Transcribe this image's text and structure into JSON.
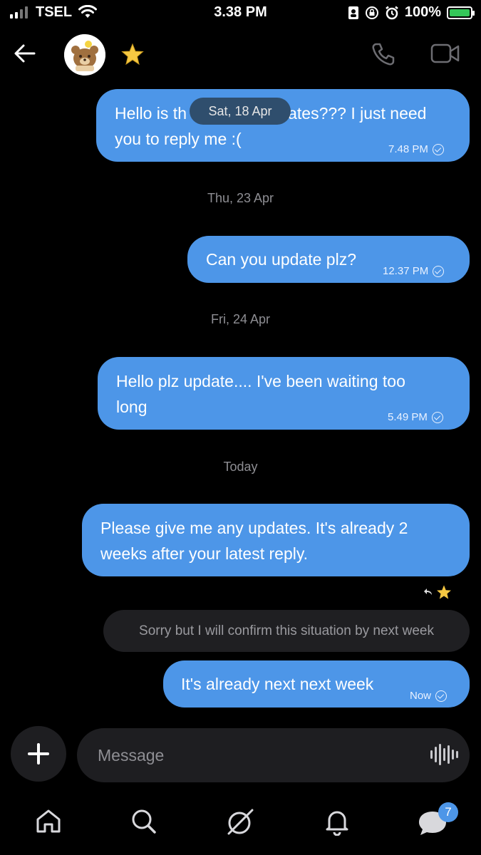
{
  "status_bar": {
    "carrier": "TSEL",
    "time": "3.38 PM",
    "battery": "100%",
    "battery_level": 1.0
  },
  "header": {
    "back_icon": "arrow-left-icon",
    "avatar_icon": "bear-avatar",
    "favorite_icon": "star-icon",
    "call_icon": "phone-icon",
    "video_icon": "video-camera-icon"
  },
  "sticky_date": "Sat, 18 Apr",
  "messages": [
    {
      "text": "Hello is there any updates??? I just need you to reply me :(",
      "time": "7.48 PM"
    },
    {
      "date": "Thu, 23 Apr"
    },
    {
      "text": "Can you update plz?",
      "time": "12.37 PM"
    },
    {
      "date": "Fri, 24 Apr"
    },
    {
      "text": "Hello plz update.... I've been waiting too long",
      "time": "5.49 PM"
    },
    {
      "date": "Today"
    },
    {
      "text": "Please give me any updates. It's already 2 weeks after your latest reply."
    },
    {
      "received_text": "Sorry but I will confirm this situation by next week"
    },
    {
      "text": "It's already next next week",
      "time": "Now"
    }
  ],
  "bubble_lines": {
    "m1_line1_left": "Hello is th",
    "m1_line1_right": "lates??? I just need",
    "m1_line2": "you to reply me :(",
    "m3_line1": "Hello plz update.... I've been waiting too",
    "m3_line2": "long",
    "m4_line1": "Please give me any updates. It's already 2",
    "m4_line2": "weeks after your latest reply."
  },
  "composer": {
    "placeholder": "Message",
    "add_icon": "plus-icon",
    "voice_icon": "waveform-icon"
  },
  "bottom_nav": {
    "items": [
      "home-icon",
      "search-icon",
      "explore-icon",
      "bell-icon",
      "chat-icon"
    ],
    "chat_badge": "7"
  },
  "colors": {
    "sent_bubble": "#4d96e8",
    "received_bubble": "#1f1f22",
    "background": "#000000"
  }
}
